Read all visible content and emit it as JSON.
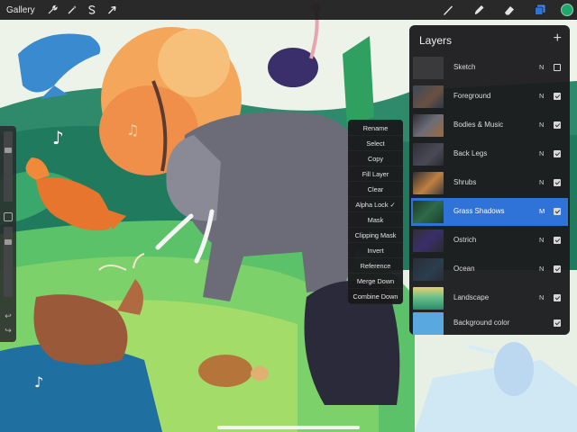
{
  "topbar": {
    "gallery_label": "Gallery",
    "left_tools": [
      "wrench-icon",
      "magic-wand-icon",
      "selection-s-icon",
      "transform-arrow-icon"
    ],
    "right_tools": [
      "brush-icon",
      "smudge-icon",
      "eraser-icon",
      "layers-icon"
    ],
    "current_color": "#1fa86b"
  },
  "context_menu": {
    "items": [
      "Rename",
      "Select",
      "Copy",
      "Fill Layer",
      "Clear",
      "Alpha Lock ✓",
      "Mask",
      "Clipping Mask",
      "Invert",
      "Reference",
      "Merge Down",
      "Combine Down"
    ]
  },
  "layers": {
    "title": "Layers",
    "add_label": "+",
    "items": [
      {
        "name": "Sketch",
        "blend": "N",
        "visible": false,
        "active": false
      },
      {
        "name": "Foreground",
        "blend": "N",
        "visible": true,
        "active": false
      },
      {
        "name": "Bodies & Music",
        "blend": "N",
        "visible": true,
        "active": false
      },
      {
        "name": "Back Legs",
        "blend": "N",
        "visible": true,
        "active": false
      },
      {
        "name": "Shrubs",
        "blend": "N",
        "visible": true,
        "active": false
      },
      {
        "name": "Grass Shadows",
        "blend": "M",
        "visible": true,
        "active": true
      },
      {
        "name": "Ostrich",
        "blend": "N",
        "visible": true,
        "active": false
      },
      {
        "name": "Ocean",
        "blend": "N",
        "visible": true,
        "active": false
      },
      {
        "name": "Landscape",
        "blend": "N",
        "visible": true,
        "active": false
      },
      {
        "name": "Background color",
        "blend": "",
        "visible": true,
        "active": false
      }
    ]
  },
  "sidebar": {
    "brush_size": 0.75,
    "opacity": 0.8,
    "undo_label": "↩",
    "redo_label": "↪"
  },
  "colors": {
    "accent": "#2f72d8",
    "panel": "#1c1c1e"
  }
}
